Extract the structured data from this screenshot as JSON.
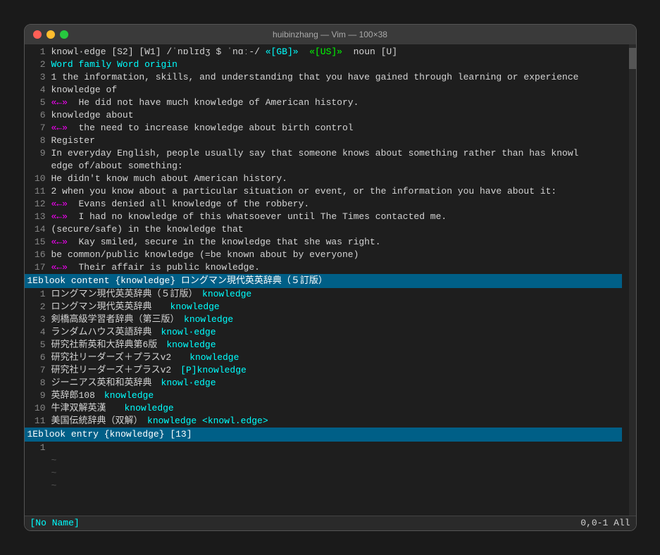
{
  "window": {
    "title": "huibinzhang — Vim — 100×38",
    "titlebar_left": "🏠 huibinzhang — Vim — 100×38"
  },
  "statusbar": {
    "left": "[No Name]",
    "right": "0,0-1          All"
  },
  "lines": [
    {
      "num": "1",
      "content": [
        {
          "t": "knowl·edge [S2] [W1] /ˈnɒlɪdʒ $ ˈnɑː-/ ",
          "c": "white"
        },
        {
          "t": "«[GB]»",
          "c": "cyan"
        },
        {
          "t": "  ",
          "c": "white"
        },
        {
          "t": "«[US]»",
          "c": "green"
        },
        {
          "t": "  noun [U]",
          "c": "white"
        }
      ]
    },
    {
      "num": "2",
      "content": [
        {
          "t": "Word family Word origin",
          "c": "cyan"
        }
      ]
    },
    {
      "num": "3",
      "content": [
        {
          "t": "1 the information, skills, and understanding that you have gained through learning or experience",
          "c": "white"
        }
      ]
    },
    {
      "num": "4",
      "content": [
        {
          "t": "knowledge of",
          "c": "white"
        }
      ]
    },
    {
      "num": "5",
      "content": [
        {
          "t": "«",
          "c": "magenta"
        },
        {
          "t": "←»",
          "c": "magenta"
        },
        {
          "t": "  He did not have much knowledge of American history.",
          "c": "white"
        }
      ]
    },
    {
      "num": "6",
      "content": [
        {
          "t": "knowledge about",
          "c": "white"
        }
      ]
    },
    {
      "num": "7",
      "content": [
        {
          "t": "«",
          "c": "magenta"
        },
        {
          "t": "←»",
          "c": "magenta"
        },
        {
          "t": "  the need to increase knowledge about birth control",
          "c": "white"
        }
      ]
    },
    {
      "num": "8",
      "content": [
        {
          "t": "Register",
          "c": "white"
        }
      ]
    },
    {
      "num": "9",
      "content": [
        {
          "t": "In everyday English, people usually say that someone knows about something rather than has knowl",
          "c": "white"
        }
      ]
    },
    {
      "num": "",
      "content": [
        {
          "t": "edge of/about something:",
          "c": "white"
        }
      ]
    },
    {
      "num": "10",
      "content": [
        {
          "t": "He didn't know much about American history.",
          "c": "white"
        }
      ]
    },
    {
      "num": "11",
      "content": [
        {
          "t": "2 when you know about a particular situation or event, or the information you have about it:",
          "c": "white"
        }
      ]
    },
    {
      "num": "12",
      "content": [
        {
          "t": "«",
          "c": "magenta"
        },
        {
          "t": "←»",
          "c": "magenta"
        },
        {
          "t": "  Evans denied all knowledge of the robbery.",
          "c": "white"
        }
      ]
    },
    {
      "num": "13",
      "content": [
        {
          "t": "«",
          "c": "magenta"
        },
        {
          "t": "←»",
          "c": "magenta"
        },
        {
          "t": "  I had no knowledge of this whatsoever until The Times contacted me.",
          "c": "white"
        }
      ]
    },
    {
      "num": "14",
      "content": [
        {
          "t": "(secure/safe) in the knowledge that",
          "c": "white"
        }
      ]
    },
    {
      "num": "15",
      "content": [
        {
          "t": "«",
          "c": "magenta"
        },
        {
          "t": "←»",
          "c": "magenta"
        },
        {
          "t": "  Kay smiled, secure in the knowledge that she was right.",
          "c": "white"
        }
      ]
    },
    {
      "num": "16",
      "content": [
        {
          "t": "be common/public knowledge (=be known about by everyone)",
          "c": "white"
        }
      ]
    },
    {
      "num": "17",
      "content": [
        {
          "t": "«",
          "c": "magenta"
        },
        {
          "t": "←»",
          "c": "magenta"
        },
        {
          "t": "  Their affair is public knowledge.",
          "c": "white"
        }
      ]
    }
  ],
  "eblock1": {
    "label": "1Eblook content {knowledge} ロングマン現代英英辞典（５訂版）",
    "items": [
      {
        "num": "1",
        "text": "ロングマン現代英英辞典（５訂版）",
        "highlight": "knowledge"
      },
      {
        "num": "2",
        "text": "ロングマン現代英英辞典",
        "highlight": "knowledge"
      },
      {
        "num": "3",
        "text": "剣橋高級学習者辞典（第三版）",
        "highlight": "knowledge"
      },
      {
        "num": "4",
        "text": "ランダムハウス英語辞典",
        "highlight": "knowl·edge"
      },
      {
        "num": "5",
        "text": "研究社新英和大辞典第6版",
        "highlight": "knowledge"
      },
      {
        "num": "6",
        "text": "研究社リーダーズ＋プラスv2",
        "highlight": "knowledge"
      },
      {
        "num": "7",
        "text": "研究社リーダーズ＋プラスv2",
        "highlight": "[P]knowledge"
      },
      {
        "num": "8",
        "text": "ジーニアス英和和英辞典",
        "highlight": "knowl·edge"
      },
      {
        "num": "9",
        "text": "英辞郎108",
        "highlight": "knowledge"
      },
      {
        "num": "10",
        "text": "牛津双解英漢",
        "highlight": "knowledge"
      },
      {
        "num": "11",
        "text": "美国伝統辞典（双解）",
        "highlight": "knowledge <knowl.edge>"
      }
    ]
  },
  "eblock2": {
    "label": "1Eblook entry {knowledge} [13]"
  },
  "tilde_lines": [
    "~",
    "~",
    "~"
  ]
}
